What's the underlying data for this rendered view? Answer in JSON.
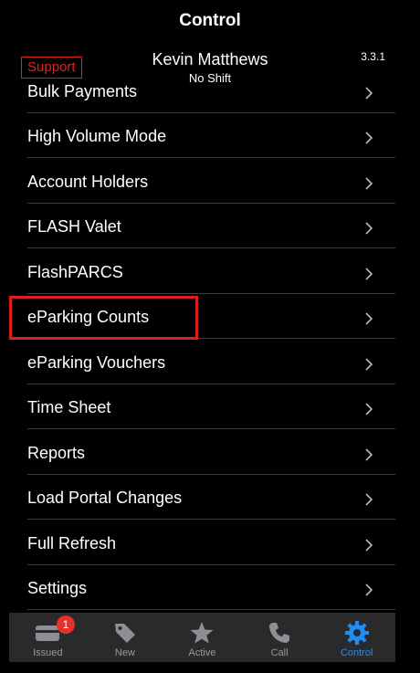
{
  "header": {
    "title": "Control",
    "support_label": "Support",
    "user_name": "Kevin Matthews",
    "shift_status": "No Shift",
    "version": "3.3.1"
  },
  "menu": {
    "items": [
      {
        "label": "Bulk Payments"
      },
      {
        "label": "High Volume Mode"
      },
      {
        "label": "Account Holders"
      },
      {
        "label": "FLASH Valet"
      },
      {
        "label": "FlashPARCS"
      },
      {
        "label": "eParking Counts"
      },
      {
        "label": "eParking Vouchers"
      },
      {
        "label": "Time Sheet"
      },
      {
        "label": "Reports"
      },
      {
        "label": "Load Portal Changes"
      },
      {
        "label": "Full Refresh"
      },
      {
        "label": "Settings"
      }
    ],
    "highlighted_item": "eParking Counts"
  },
  "tabbar": {
    "tabs": [
      {
        "label": "Issued",
        "icon": "ticket-icon",
        "badge": "1"
      },
      {
        "label": "New",
        "icon": "tag-icon"
      },
      {
        "label": "Active",
        "icon": "star-icon"
      },
      {
        "label": "Call",
        "icon": "phone-icon"
      },
      {
        "label": "Control",
        "icon": "gear-icon",
        "active": true
      }
    ]
  },
  "colors": {
    "accent": "#1e8ef5",
    "support_red": "#e0201c",
    "highlight_red": "#d92020",
    "badge_red": "#e8302a"
  }
}
